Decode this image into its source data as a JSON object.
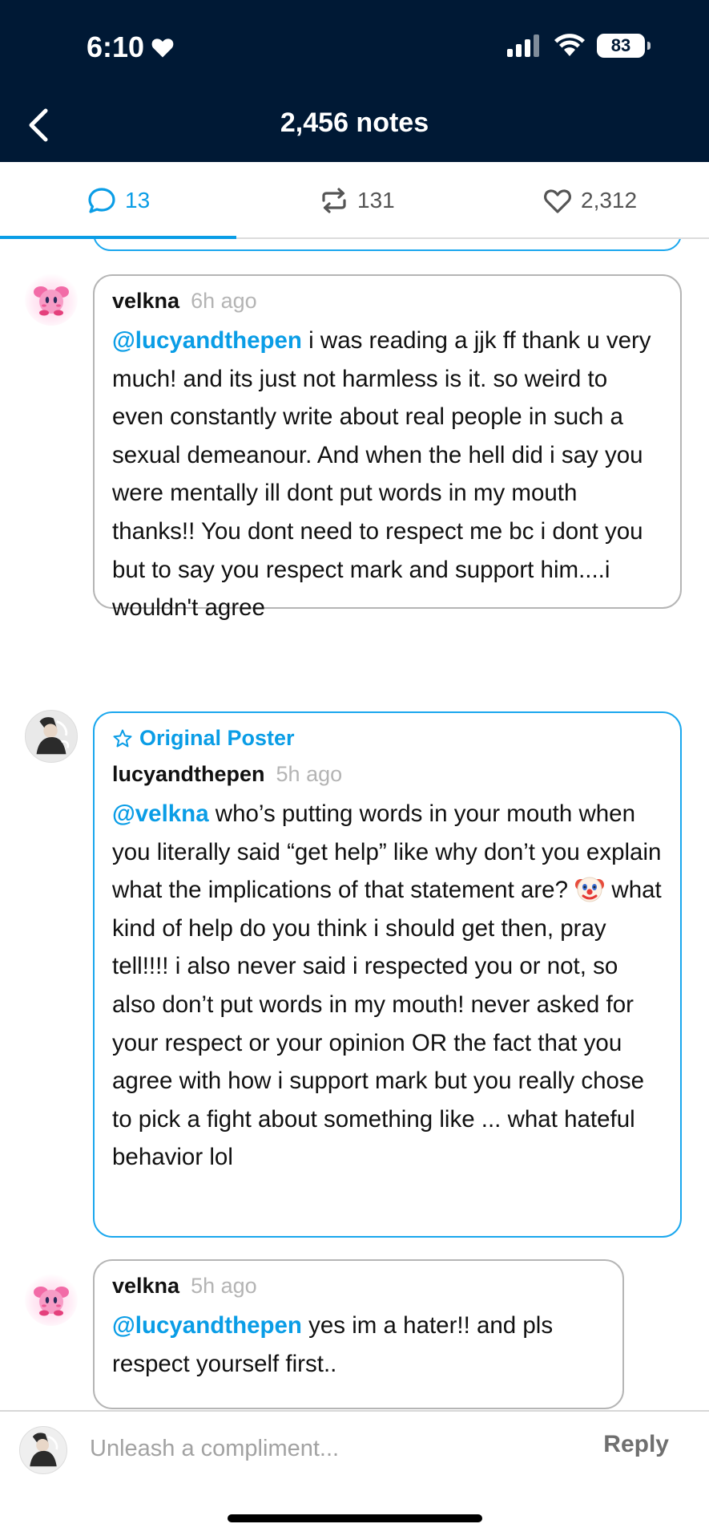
{
  "status_bar": {
    "time": "6:10",
    "battery": "83"
  },
  "header": {
    "title": "2,456 notes"
  },
  "tabs": [
    {
      "label": "13",
      "icon": "comment-icon",
      "active": true
    },
    {
      "label": "131",
      "icon": "reblog-icon",
      "active": false
    },
    {
      "label": "2,312",
      "icon": "heart-icon",
      "active": false
    }
  ],
  "comments": [
    {
      "username": "velkna",
      "time": "6h ago",
      "mention": "@lucyandthepen",
      "text": " i was reading a jjk ff thank u very much! and its just not harmless is it. so weird to even constantly write about real people in such a sexual demeanour. And when the hell did i say you were mentally ill dont put words in my mouth thanks!! You dont need to respect me bc i dont you but to say you respect mark and support him....i wouldn't agree"
    },
    {
      "badge": "Original Poster",
      "username": "lucyandthepen",
      "time": "5h ago",
      "mention": "@velkna",
      "text_before_emoji": " who’s putting words in your mouth when you literally said “get help” like why don’t you explain what the implications of that statement are? ",
      "text_after_emoji": " what kind of help do you think i should get then, pray tell!!!! i also never said i respected you or not, so also don’t put words in my mouth! never asked for your respect or your opinion OR the fact that you agree with how i support mark but you really chose to pick a fight about something like ... what hateful behavior lol"
    },
    {
      "username": "velkna",
      "time": "5h ago",
      "mention": "@lucyandthepen",
      "text": " yes im a hater!! and pls respect yourself first.."
    }
  ],
  "composer": {
    "placeholder": "Unleash a compliment...",
    "reply_label": "Reply"
  },
  "colors": {
    "header_bg": "#001935",
    "accent": "#0a9de6",
    "bubble_border": "#b5b5b5"
  }
}
